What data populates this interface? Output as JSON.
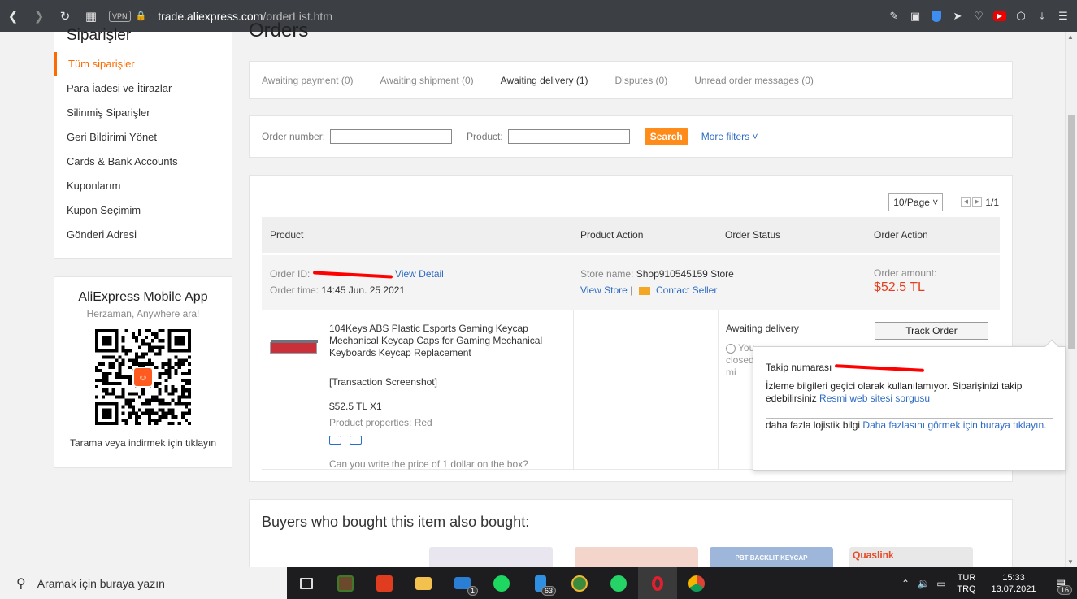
{
  "browser": {
    "vpn_label": "VPN",
    "url_domain": "trade.aliexpress.com",
    "url_path": "/orderList.htm"
  },
  "sidebar": {
    "title": "Siparişler",
    "items": [
      {
        "label": "Tüm siparişler"
      },
      {
        "label": "Para İadesi ve İtirazlar"
      },
      {
        "label": "Silinmiş Siparişler"
      },
      {
        "label": "Geri Bildirimi Yönet"
      },
      {
        "label": "Cards & Bank Accounts"
      },
      {
        "label": "Kuponlarım"
      },
      {
        "label": "Kupon Seçimim"
      },
      {
        "label": "Gönderi Adresi"
      }
    ],
    "app": {
      "title": "AliExpress Mobile App",
      "subtitle": "Herzaman, Anywhere ara!",
      "footer": "Tarama veya indirmek için tıklayın"
    }
  },
  "main": {
    "title": "Orders",
    "tabs": [
      {
        "label": "Awaiting payment (0)"
      },
      {
        "label": "Awaiting shipment (0)"
      },
      {
        "label": "Awaiting delivery (1)"
      },
      {
        "label": "Disputes (0)"
      },
      {
        "label": "Unread order messages (0)"
      }
    ],
    "filters": {
      "order_number_label": "Order number:",
      "product_label": "Product:",
      "search_label": "Search",
      "more_filters_label": "More filters ˅"
    },
    "pager": {
      "per_page": "10/Page ˅",
      "count": "1/1"
    },
    "table_headers": [
      "Product",
      "Product Action",
      "Order Status",
      "Order Action"
    ],
    "order": {
      "id_label": "Order ID:",
      "view_detail": "View Detail",
      "time_label": "Order time:",
      "time_value": "14:45 Jun. 25 2021",
      "store_label": "Store name:",
      "store_value": "Shop910545159 Store",
      "view_store": "View Store",
      "separator": "|",
      "contact_seller": "Contact Seller",
      "amount_label": "Order amount:",
      "amount_value": "$52.5 TL",
      "product_name": "104Keys ABS Plastic Esports Gaming Keycap Mechanical Keycap Caps for Gaming Mechanical Keyboards Keycap Replacement",
      "transaction": "[Transaction Screenshot]",
      "price_qty": "$52.5 TL X1",
      "properties": "Product properties: Red",
      "question": "Can you write the price of 1 dollar on the box?",
      "status": "Awaiting delivery",
      "status_sub": "You closed 17 mi",
      "track_label": "Track Order"
    },
    "popup": {
      "tracking_label": "Takip numarası",
      "info_text": "İzleme bilgileri geçici olarak kullanılamıyor. Siparişinizi takip edebilirsiniz",
      "info_link": "Resmi web sitesi sorgusu",
      "more_text": "daha fazla lojistik bilgi",
      "more_link": "Daha fazlasını görmek için buraya tıklayın."
    },
    "recommend": {
      "title": "Buyers who bought this item also bought:",
      "items": [
        {
          "caption": ""
        },
        {
          "caption": ""
        },
        {
          "caption": "PBT BACKLIT KEYCAP"
        },
        {
          "caption": "Quaslink"
        }
      ]
    }
  },
  "taskbar": {
    "search_placeholder": "Aramak için buraya yazın",
    "mail_badge": "1",
    "files_badge": "63",
    "lang_top": "TUR",
    "lang_bottom": "TRQ",
    "time": "15:33",
    "date": "13.07.2021",
    "notif_count": "16"
  },
  "colors": {
    "accent": "#ff6a00",
    "link": "#2d6bc4",
    "price": "#e43e1c"
  }
}
